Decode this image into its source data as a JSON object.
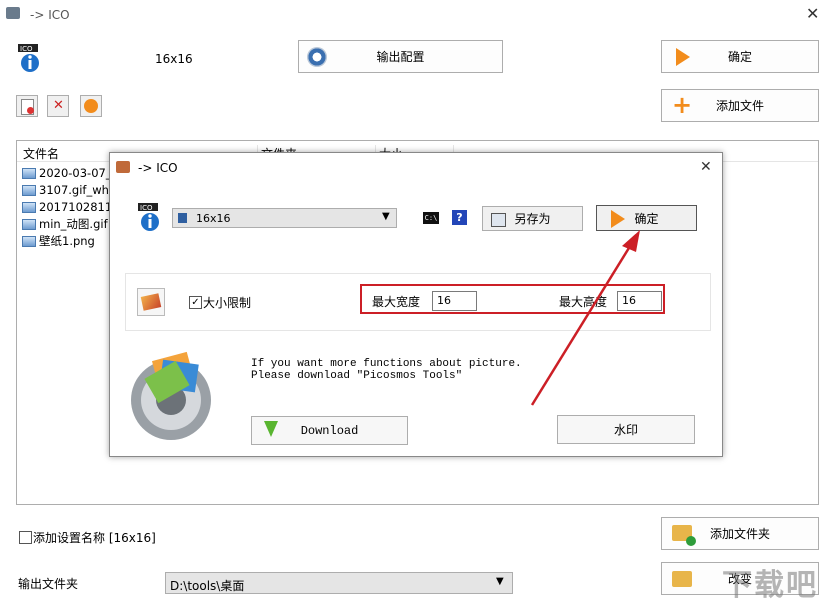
{
  "main": {
    "title": "-> ICO",
    "size_label": "16x16",
    "output_config_button": "输出配置",
    "ok_button": "确定",
    "add_file_button": "添加文件",
    "add_folder_button": "添加文件夹",
    "change_button": "改变",
    "columns": [
      "文件名",
      "文件夹",
      "大小"
    ],
    "files": [
      "2020-03-07_0",
      "3107.gif_wh30",
      "201710281130",
      "min_动图.gif",
      "壁纸1.png"
    ],
    "add_setting_name_label": "添加设置名称 [16x16]",
    "output_folder_label": "输出文件夹",
    "output_folder_value": "D:\\tools\\桌面"
  },
  "dialog": {
    "title": "-> ICO",
    "size_select": "16x16",
    "save_as_button": "另存为",
    "ok_button": "确定",
    "size_limit_label": "大小限制",
    "max_width_label": "最大宽度",
    "max_width_value": "16",
    "max_height_label": "最大高度",
    "max_height_value": "16",
    "info_line1": "If you want more functions about picture.",
    "info_line2": "Please download \"Picosmos Tools\"",
    "download_button": "Download",
    "watermark_button": "水印"
  },
  "watermark_text": "下载吧",
  "colors": {
    "annotation_red": "#cc1f26",
    "accent_orange": "#f28c1c"
  }
}
